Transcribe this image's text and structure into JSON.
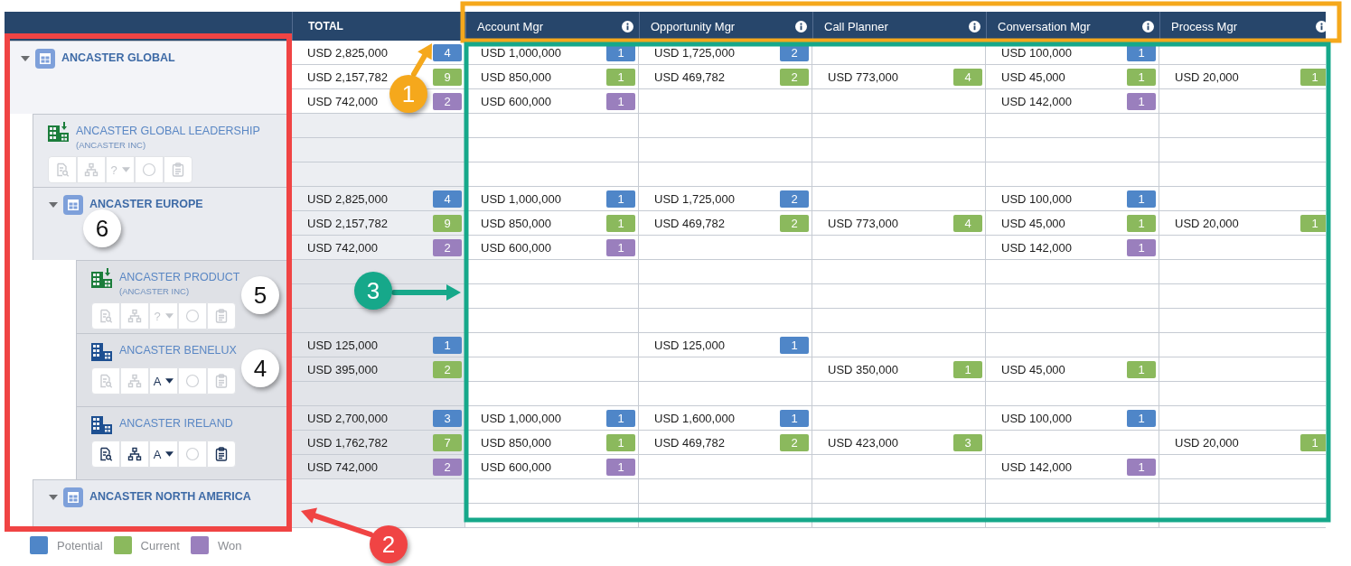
{
  "table": {
    "columns": [
      {
        "label": "TOTAL",
        "kind": "total"
      },
      {
        "label": "Account Mgr",
        "kind": "manager"
      },
      {
        "label": "Opportunity Mgr",
        "kind": "manager"
      },
      {
        "label": "Call Planner",
        "kind": "manager"
      },
      {
        "label": "Conversation Mgr",
        "kind": "manager"
      },
      {
        "label": "Process Mgr",
        "kind": "manager"
      }
    ],
    "accounts": [
      {
        "name": "ANCASTER GLOBAL",
        "kind": "group",
        "expanded": true,
        "rows": [
          {
            "total": {
              "amount": "USD 2,825,000",
              "count": "4"
            },
            "cells": [
              {
                "amount": "USD 1,000,000",
                "count": "1"
              },
              {
                "amount": "USD 1,725,000",
                "count": "2"
              },
              null,
              {
                "amount": "USD 100,000",
                "count": "1"
              },
              null
            ]
          },
          {
            "total": {
              "amount": "USD 2,157,782",
              "count": "9"
            },
            "cells": [
              {
                "amount": "USD 850,000",
                "count": "1"
              },
              {
                "amount": "USD 469,782",
                "count": "2"
              },
              {
                "amount": "USD 773,000",
                "count": "4"
              },
              {
                "amount": "USD 45,000",
                "count": "1"
              },
              {
                "amount": "USD 20,000",
                "count": "1"
              }
            ]
          },
          {
            "total": {
              "amount": "USD 742,000",
              "count": "2"
            },
            "cells": [
              {
                "amount": "USD 600,000",
                "count": "1"
              },
              null,
              null,
              {
                "amount": "USD 142,000",
                "count": "1"
              },
              null
            ]
          }
        ],
        "children": [
          {
            "name": "ANCASTER GLOBAL LEADERSHIP",
            "subtitle": "(ANCASTER INC)",
            "kind": "imported",
            "toolbar": {
              "actions_enabled": false,
              "grade": "?",
              "grade_enabled": false
            },
            "rows": [
              {
                "total": null,
                "cells": [
                  null,
                  null,
                  null,
                  null,
                  null
                ]
              },
              {
                "total": null,
                "cells": [
                  null,
                  null,
                  null,
                  null,
                  null
                ]
              },
              {
                "total": null,
                "cells": [
                  null,
                  null,
                  null,
                  null,
                  null
                ]
              }
            ]
          },
          {
            "name": "ANCASTER EUROPE",
            "kind": "group",
            "expanded": true,
            "rows": [
              {
                "total": {
                  "amount": "USD 2,825,000",
                  "count": "4"
                },
                "cells": [
                  {
                    "amount": "USD 1,000,000",
                    "count": "1"
                  },
                  {
                    "amount": "USD 1,725,000",
                    "count": "2"
                  },
                  null,
                  {
                    "amount": "USD 100,000",
                    "count": "1"
                  },
                  null
                ]
              },
              {
                "total": {
                  "amount": "USD 2,157,782",
                  "count": "9"
                },
                "cells": [
                  {
                    "amount": "USD 850,000",
                    "count": "1"
                  },
                  {
                    "amount": "USD 469,782",
                    "count": "2"
                  },
                  {
                    "amount": "USD 773,000",
                    "count": "4"
                  },
                  {
                    "amount": "USD 45,000",
                    "count": "1"
                  },
                  {
                    "amount": "USD 20,000",
                    "count": "1"
                  }
                ]
              },
              {
                "total": {
                  "amount": "USD 742,000",
                  "count": "2"
                },
                "cells": [
                  {
                    "amount": "USD 600,000",
                    "count": "1"
                  },
                  null,
                  null,
                  {
                    "amount": "USD 142,000",
                    "count": "1"
                  },
                  null
                ]
              }
            ],
            "children": [
              {
                "name": "ANCASTER PRODUCT",
                "subtitle": "(ANCASTER INC)",
                "kind": "imported",
                "toolbar": {
                  "actions_enabled": false,
                  "grade": "?",
                  "grade_enabled": false
                },
                "rows": [
                  {
                    "total": null,
                    "cells": [
                      null,
                      null,
                      null,
                      null,
                      null
                    ]
                  },
                  {
                    "total": null,
                    "cells": [
                      null,
                      null,
                      null,
                      null,
                      null
                    ]
                  },
                  {
                    "total": null,
                    "cells": [
                      null,
                      null,
                      null,
                      null,
                      null
                    ]
                  }
                ]
              },
              {
                "name": "ANCASTER BENELUX",
                "kind": "account",
                "toolbar": {
                  "actions_enabled": false,
                  "grade": "A",
                  "grade_enabled": true
                },
                "rows": [
                  {
                    "total": {
                      "amount": "USD 125,000",
                      "count": "1"
                    },
                    "cells": [
                      null,
                      {
                        "amount": "USD 125,000",
                        "count": "1"
                      },
                      null,
                      null,
                      null
                    ]
                  },
                  {
                    "total": {
                      "amount": "USD 395,000",
                      "count": "2"
                    },
                    "cells": [
                      null,
                      null,
                      {
                        "amount": "USD 350,000",
                        "count": "1"
                      },
                      {
                        "amount": "USD 45,000",
                        "count": "1"
                      },
                      null
                    ]
                  },
                  {
                    "total": null,
                    "cells": [
                      null,
                      null,
                      null,
                      null,
                      null
                    ]
                  }
                ]
              },
              {
                "name": "ANCASTER IRELAND",
                "kind": "account",
                "toolbar": {
                  "actions_enabled": true,
                  "grade": "A",
                  "grade_enabled": true
                },
                "rows": [
                  {
                    "total": {
                      "amount": "USD 2,700,000",
                      "count": "3"
                    },
                    "cells": [
                      {
                        "amount": "USD 1,000,000",
                        "count": "1"
                      },
                      {
                        "amount": "USD 1,600,000",
                        "count": "1"
                      },
                      null,
                      {
                        "amount": "USD 100,000",
                        "count": "1"
                      },
                      null
                    ]
                  },
                  {
                    "total": {
                      "amount": "USD 1,762,782",
                      "count": "7"
                    },
                    "cells": [
                      {
                        "amount": "USD 850,000",
                        "count": "1"
                      },
                      {
                        "amount": "USD 469,782",
                        "count": "2"
                      },
                      {
                        "amount": "USD 423,000",
                        "count": "3"
                      },
                      null,
                      {
                        "amount": "USD 20,000",
                        "count": "1"
                      }
                    ]
                  },
                  {
                    "total": {
                      "amount": "USD 742,000",
                      "count": "2"
                    },
                    "cells": [
                      {
                        "amount": "USD 600,000",
                        "count": "1"
                      },
                      null,
                      null,
                      {
                        "amount": "USD 142,000",
                        "count": "1"
                      },
                      null
                    ]
                  }
                ]
              }
            ]
          },
          {
            "name": "ANCASTER NORTH AMERICA",
            "kind": "group",
            "expanded": true,
            "rows": [
              {
                "total": null,
                "cells": [
                  null,
                  null,
                  null,
                  null,
                  null
                ]
              },
              {
                "total": null,
                "cells": [
                  null,
                  null,
                  null,
                  null,
                  null
                ]
              }
            ]
          }
        ]
      }
    ]
  },
  "legend": [
    {
      "label": "Potential",
      "color": "#4f86c8"
    },
    {
      "label": "Current",
      "color": "#8bb95d"
    },
    {
      "label": "Won",
      "color": "#9a7fbd"
    }
  ],
  "annotations": [
    {
      "number": "1",
      "color": "#f5a81c"
    },
    {
      "number": "2",
      "color": "#f04444"
    },
    {
      "number": "3",
      "color": "#16a88a"
    },
    {
      "number": "4",
      "color": "#ffffff"
    },
    {
      "number": "5",
      "color": "#ffffff"
    },
    {
      "number": "6",
      "color": "#ffffff"
    }
  ]
}
